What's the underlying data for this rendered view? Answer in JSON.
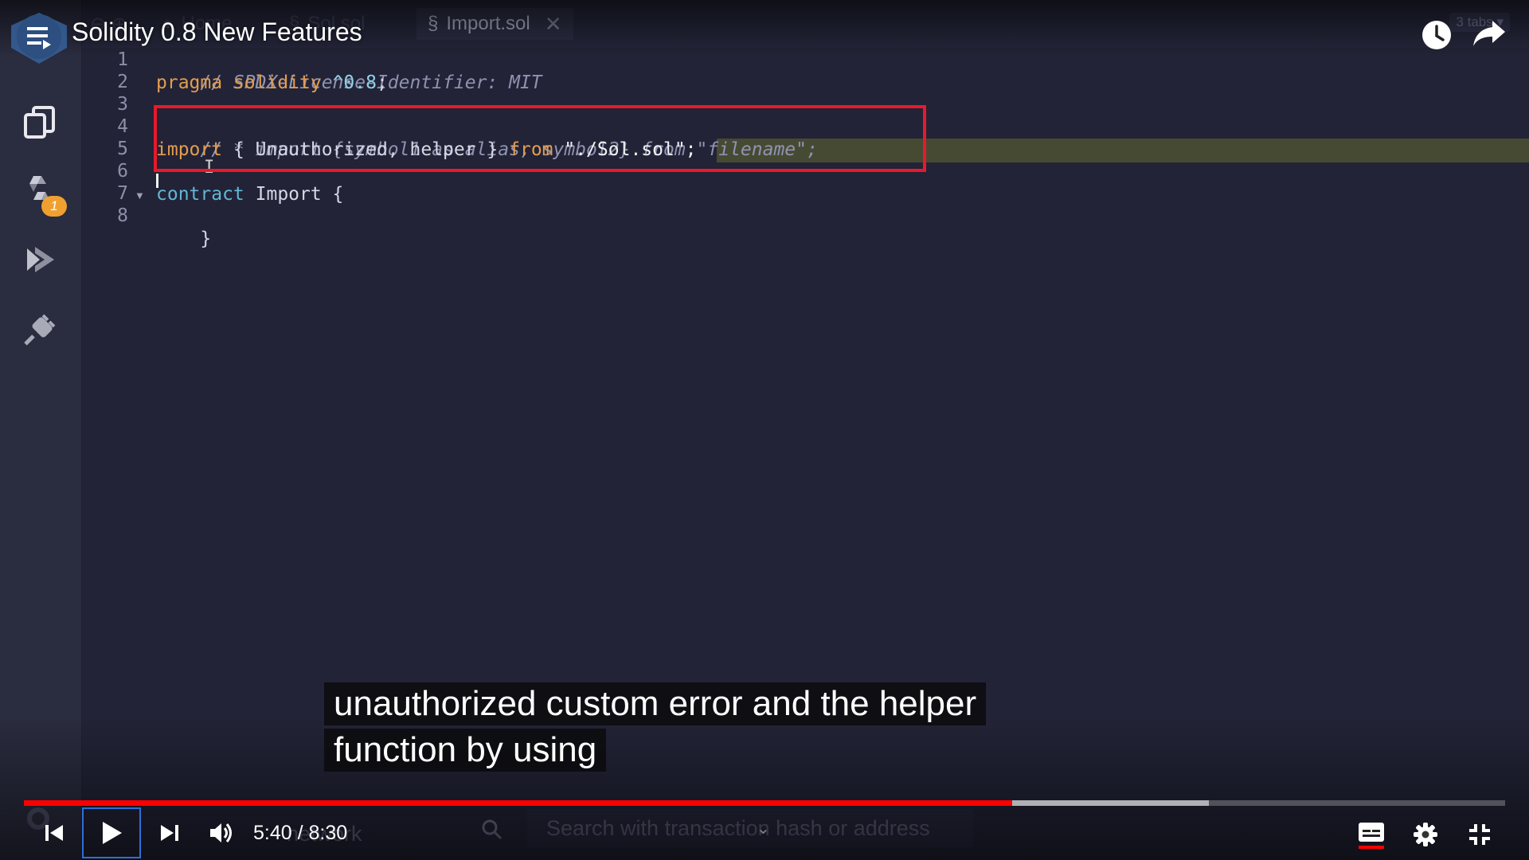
{
  "video": {
    "title": "Solidity 0.8 New Features",
    "time_current": "5:40",
    "time_separator": "/",
    "time_total": "8:30",
    "progress": 0.667,
    "buffered": 0.8
  },
  "tabs": {
    "items": [
      {
        "label": "Home",
        "faded": true
      },
      {
        "label": "Sol.sol",
        "faded": true
      },
      {
        "label": "Import.sol",
        "active": true
      }
    ],
    "count_label": "3 tabs"
  },
  "side_panel": {
    "icons": [
      "file-explorer-icon",
      "solidity-compiler-icon",
      "deploy-run-icon",
      "plugin-manager-icon"
    ],
    "compiler_badge": "1"
  },
  "editor": {
    "line_numbers": [
      "1",
      "2",
      "3",
      "4",
      "5",
      "6",
      "7",
      "8"
    ],
    "lines": {
      "l1": "// SPDX-License-Identifier: MIT",
      "l2_kw": "pragma solidity",
      "l2_ver": "^0.8",
      "l2_end": ";",
      "l4": "// * import {symbol1 as alias, symbol2} from \"filename\";",
      "l5_kw": "import",
      "l5_mid": " { Unauthorized, helper } ",
      "l5_from": "from",
      "l5_str": " \"./Sol.sol\";",
      "l7_kw": "contract",
      "l7_rest": " Import {",
      "l8": "}"
    }
  },
  "captions": {
    "line1": "unauthorized custom error and the helper",
    "line2": "function by using"
  },
  "footer": {
    "faded_text": "network",
    "search_placeholder": "Search with transaction hash or address"
  },
  "colors": {
    "accent_red": "#ff0000",
    "highlight_box": "#e8192c",
    "editor_bg": "#222336",
    "badge": "#f0a030"
  }
}
